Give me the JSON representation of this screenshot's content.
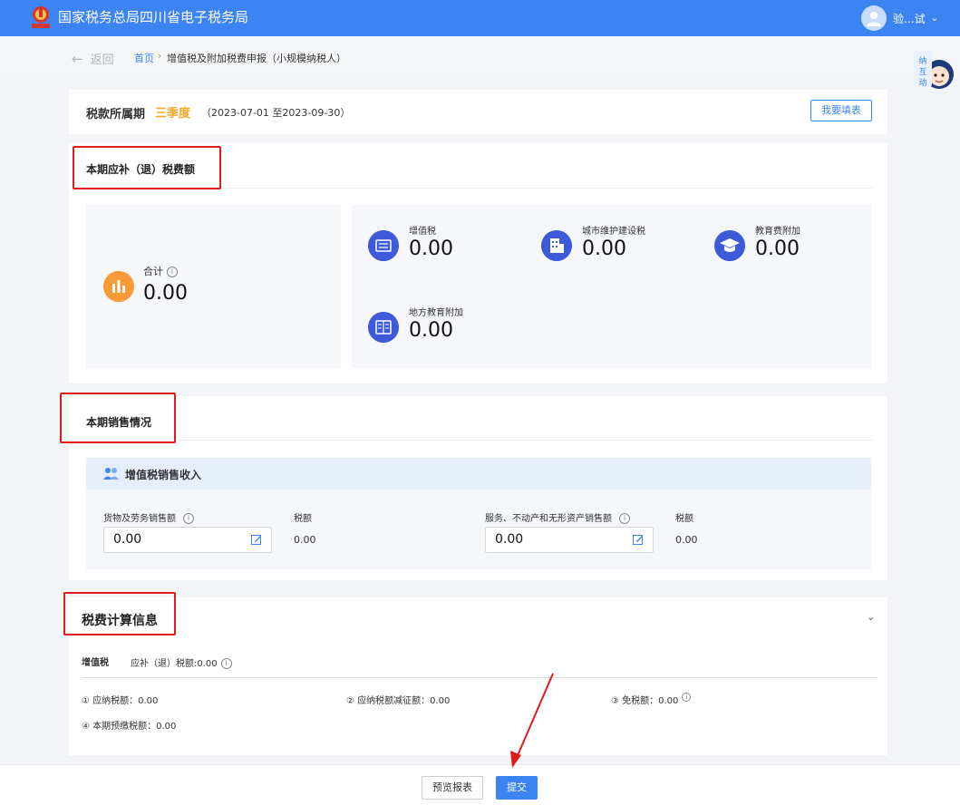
{
  "header": {
    "app_title": "国家税务总局四川省电子税务局",
    "user_name": "验...试"
  },
  "subnav": {
    "back_label": "返回",
    "home_label": "首页",
    "separator": "›",
    "current_label": "增值税及附加税费申报（小规模纳税人）"
  },
  "period": {
    "label": "税款所属期",
    "value": "三季度",
    "range": "（2023-07-01 至2023-09-30）",
    "fill_button": "我要填表"
  },
  "tax_due": {
    "section_title": "本期应补（退）税费额",
    "total": {
      "label": "合计",
      "value": "0.00"
    },
    "items": [
      {
        "label": "增值税",
        "value": "0.00",
        "icon": "tax-document-icon"
      },
      {
        "label": "城市维护建设税",
        "value": "0.00",
        "icon": "building-icon"
      },
      {
        "label": "教育费附加",
        "value": "0.00",
        "icon": "graduation-cap-icon"
      },
      {
        "label": "地方教育附加",
        "value": "0.00",
        "icon": "book-icon"
      }
    ]
  },
  "sales": {
    "section_title": "本期销售情况",
    "panel_title": "增值税销售收入",
    "goods": {
      "label": "货物及劳务销售额",
      "value": "0.00",
      "tax_label": "税额",
      "tax_value": "0.00"
    },
    "services": {
      "label": "服务、不动产和无形资产销售额",
      "value": "0.00",
      "tax_label": "税额",
      "tax_value": "0.00"
    }
  },
  "calc": {
    "section_title": "税费计算信息",
    "vat_label": "增值税",
    "vat_summary": "应补（退）税额:0.00",
    "lines": [
      "① 应纳税额：0.00",
      "② 应纳税额减征额：0.00",
      "③ 免税额：0.00",
      "④ 本期预缴税额：0.00"
    ]
  },
  "footer": {
    "preview_button": "预览报表",
    "submit_button": "提交"
  },
  "colors": {
    "brand": "#3d84f3",
    "highlight": "#f5a623",
    "annotation": "#e21a1a",
    "total_icon": "#f89a38",
    "item_icon": "#3d5bd9"
  }
}
